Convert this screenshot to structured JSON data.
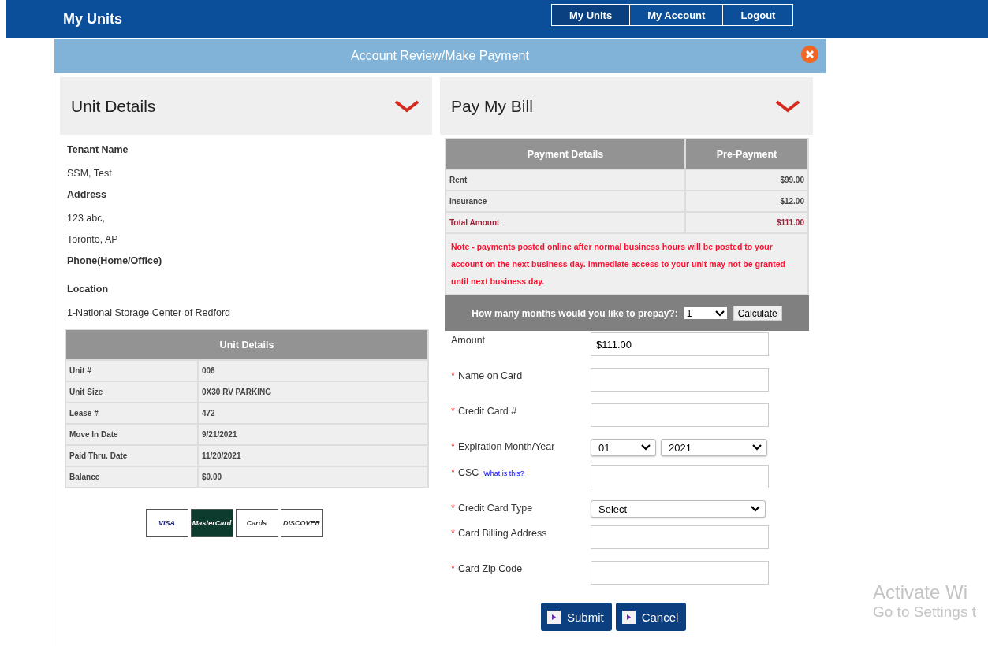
{
  "top_bar": {
    "brand": "My Units",
    "nav": [
      {
        "label": "My Units",
        "selected": true
      },
      {
        "label": "My Account",
        "selected": false
      },
      {
        "label": "Logout",
        "selected": false
      }
    ]
  },
  "dialog": {
    "title": "Account Review/Make Payment"
  },
  "unit_panel": {
    "title": "Unit Details",
    "expanded": true,
    "info": [
      {
        "kind": "label",
        "text": "Tenant Name"
      },
      {
        "kind": "value",
        "text": "SSM, Test"
      },
      {
        "kind": "label",
        "text": "Address"
      },
      {
        "kind": "value",
        "text": "123 abc,"
      },
      {
        "kind": "value",
        "text": "Toronto, AP"
      },
      {
        "kind": "label",
        "text": "Phone(Home/Office)"
      },
      {
        "kind": "gap"
      },
      {
        "kind": "label",
        "text": "Location"
      },
      {
        "kind": "value",
        "text": "1-National Storage Center of Redford"
      }
    ],
    "table": {
      "title": "Unit Details",
      "rows": [
        [
          "Unit #",
          "006"
        ],
        [
          "Unit Size",
          "0X30 RV PARKING"
        ],
        [
          "Lease #",
          "472"
        ],
        [
          "Move In Date",
          "9/21/2021"
        ],
        [
          "Paid Thru. Date",
          "11/20/2021"
        ],
        [
          "Balance",
          "$0.00"
        ]
      ]
    },
    "card_logos": [
      {
        "kind": "visa",
        "label": "VISA"
      },
      {
        "kind": "mastercard",
        "label": "MasterCard"
      },
      {
        "kind": "amex",
        "label": "Cards"
      },
      {
        "kind": "discover",
        "label": "DISCOVER"
      }
    ]
  },
  "pay_panel": {
    "title": "Pay My Bill",
    "expanded": true,
    "table": {
      "columns": [
        "Payment Details",
        "Pre-Payment"
      ],
      "rows": [
        {
          "kind": "item",
          "label": "Rent",
          "amount": "$99.00"
        },
        {
          "kind": "item",
          "label": "Insurance",
          "amount": "$12.00"
        },
        {
          "kind": "total",
          "label": "Total Amount",
          "amount": "$111.00"
        }
      ]
    },
    "note": "Note - payments posted online after normal business hours will be posted to your account on the next business day. Immediate access to your unit may not be granted until next business day.",
    "prepay": {
      "label": "How many months would you like to prepay?:",
      "months": "1",
      "button": "Calculate"
    },
    "form": [
      {
        "kind": "text",
        "label": "Amount",
        "value": "$111.00"
      },
      {
        "kind": "text",
        "marker": "*",
        "label": "Name on  Card"
      },
      {
        "kind": "text",
        "marker": "*",
        "label": "Credit Card #"
      },
      {
        "kind": "pair",
        "marker": "*",
        "label": "Expiration Month/Year",
        "month": "01",
        "year": "2021"
      },
      {
        "kind": "text",
        "marker": "*",
        "label": "CSC",
        "link": "What is this?"
      },
      {
        "kind": "select",
        "marker": "*",
        "label": "Credit Card Type",
        "value": "Select"
      },
      {
        "kind": "text",
        "marker": "*",
        "label": "Card Billing Address"
      },
      {
        "kind": "text",
        "marker": "*",
        "label": "Card Zip Code"
      }
    ],
    "buttons": [
      "Submit",
      "Cancel"
    ]
  },
  "os_watermark": {
    "line_1": "Activate Wi",
    "line_2": "Go to Settings t"
  }
}
